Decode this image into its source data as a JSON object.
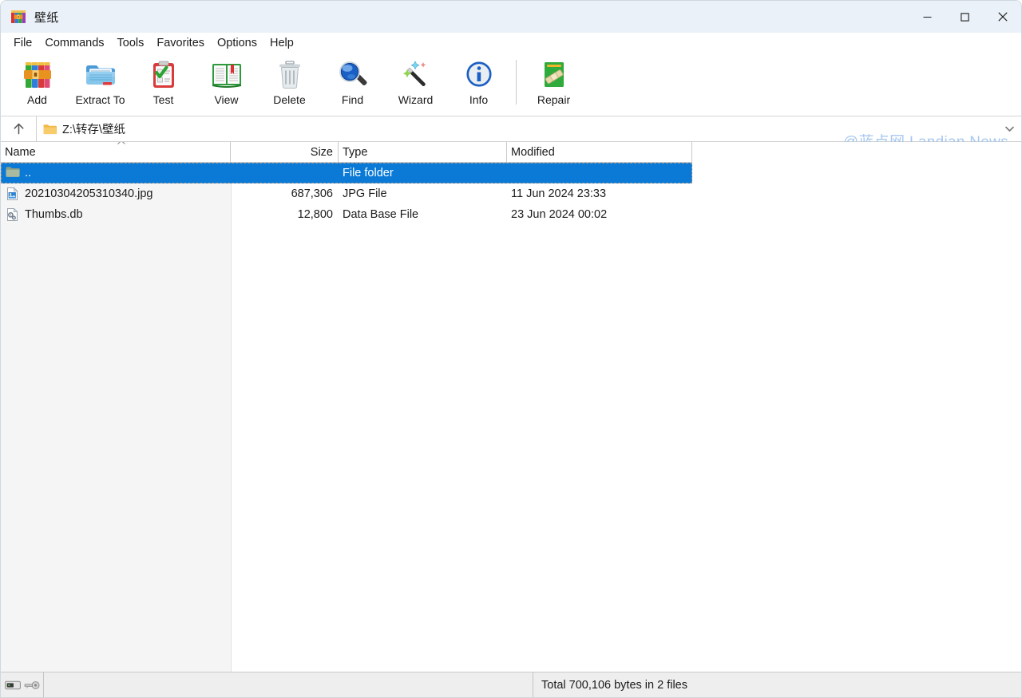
{
  "window": {
    "title": "壁纸",
    "app_icon": "winrar-books-icon",
    "controls": {
      "minimize": "minimize-icon",
      "maximize": "maximize-icon",
      "close": "close-icon"
    }
  },
  "menubar": {
    "items": [
      {
        "label": "File"
      },
      {
        "label": "Commands"
      },
      {
        "label": "Tools"
      },
      {
        "label": "Favorites"
      },
      {
        "label": "Options"
      },
      {
        "label": "Help"
      }
    ]
  },
  "toolbar": {
    "buttons": [
      {
        "label": "Add",
        "icon": "add-archive-icon"
      },
      {
        "label": "Extract To",
        "icon": "extract-folder-icon"
      },
      {
        "label": "Test",
        "icon": "test-clipboard-icon"
      },
      {
        "label": "View",
        "icon": "view-book-icon"
      },
      {
        "label": "Delete",
        "icon": "delete-trash-icon"
      },
      {
        "label": "Find",
        "icon": "find-magnifier-icon"
      },
      {
        "label": "Wizard",
        "icon": "wizard-wand-icon"
      },
      {
        "label": "Info",
        "icon": "info-circle-icon"
      },
      {
        "label": "Repair",
        "icon": "repair-book-icon"
      }
    ],
    "watermark": "@蓝点网 Landian.News",
    "watermark_color": "#a8c8f0"
  },
  "addressbar": {
    "up_icon": "arrow-up-icon",
    "folder_icon": "folder-icon",
    "path": "Z:\\转存\\壁纸",
    "dropdown_icon": "chevron-down-icon"
  },
  "filelist": {
    "columns": [
      {
        "label": "Name",
        "sorted": "ascending",
        "sort_icon": "caret-up-icon"
      },
      {
        "label": "Size"
      },
      {
        "label": "Type"
      },
      {
        "label": "Modified"
      }
    ],
    "rows": [
      {
        "name": "..",
        "size": "",
        "type": "File folder",
        "modified": "",
        "icon": "folder-icon",
        "selected": true
      },
      {
        "name": "20210304205310340.jpg",
        "size": "687,306",
        "type": "JPG File",
        "modified": "11 Jun 2024 23:33",
        "icon": "jpg-file-icon",
        "selected": false
      },
      {
        "name": "Thumbs.db",
        "size": "12,800",
        "type": "Data Base File",
        "modified": "23 Jun 2024 00:02",
        "icon": "database-file-icon",
        "selected": false
      }
    ],
    "selection_color": "#0a7ad6"
  },
  "statusbar": {
    "drive_icon": "drive-icon",
    "key_icon": "key-icon",
    "total": "Total 700,106 bytes in 2 files"
  }
}
